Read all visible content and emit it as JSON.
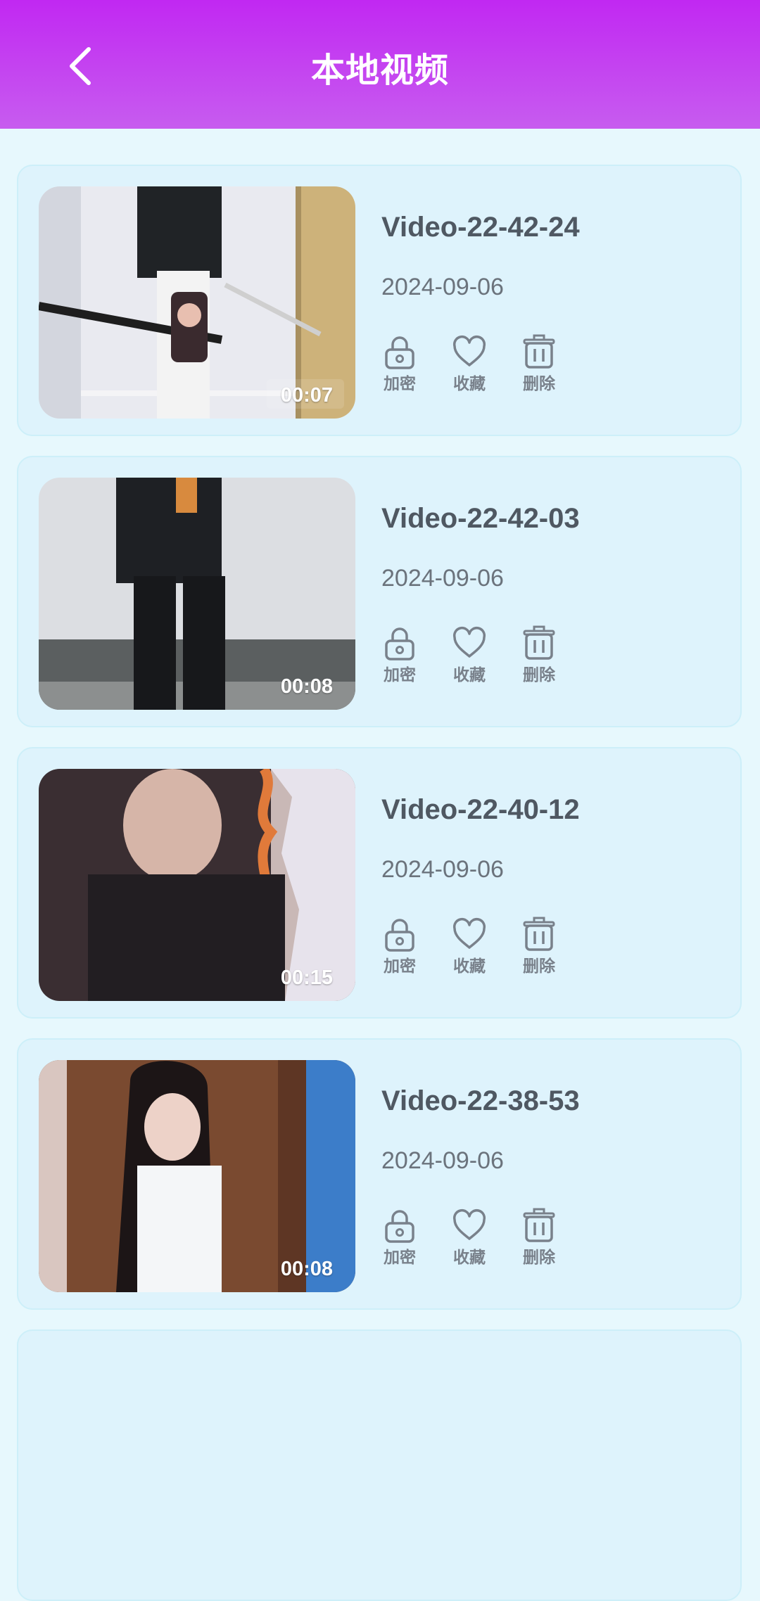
{
  "header": {
    "title": "本地视频"
  },
  "colors": {
    "header_top": "#C128F2",
    "header_bottom": "#C75CEF",
    "background": "#E7F8FD",
    "card": "#DEF3FC",
    "title_text": "#4F5862",
    "icon": "#79818B"
  },
  "videos": [
    {
      "title": "Video-22-42-24",
      "date": "2024-09-06",
      "duration": "00:07",
      "actions": {
        "encrypt": "加密",
        "favorite": "收藏",
        "delete": "删除"
      }
    },
    {
      "title": "Video-22-42-03",
      "date": "2024-09-06",
      "duration": "00:08",
      "actions": {
        "encrypt": "加密",
        "favorite": "收藏",
        "delete": "删除"
      }
    },
    {
      "title": "Video-22-40-12",
      "date": "2024-09-06",
      "duration": "00:15",
      "actions": {
        "encrypt": "加密",
        "favorite": "收藏",
        "delete": "删除"
      }
    },
    {
      "title": "Video-22-38-53",
      "date": "2024-09-06",
      "duration": "00:08",
      "actions": {
        "encrypt": "加密",
        "favorite": "收藏",
        "delete": "删除"
      }
    }
  ],
  "icons": {
    "back": "chevron-left-icon",
    "encrypt": "lock-icon",
    "favorite": "heart-icon",
    "delete": "trash-icon"
  }
}
